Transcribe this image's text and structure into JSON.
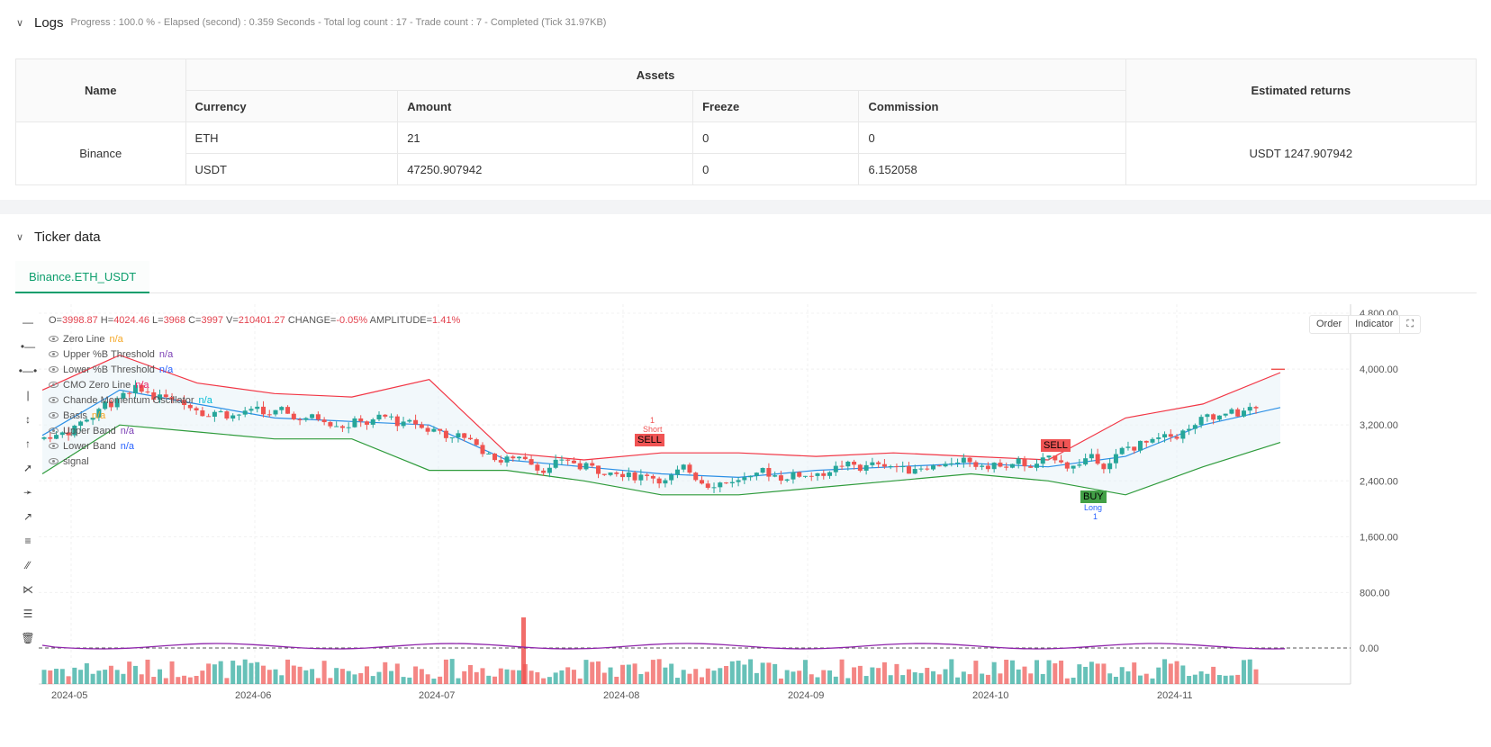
{
  "logs": {
    "title": "Logs",
    "summary": "Progress : 100.0 % - Elapsed (second) : 0.359   Seconds - Total log count : 17 - Trade count : 7 - Completed (Tick 31.97KB)"
  },
  "assets_table": {
    "name_header": "Name",
    "assets_header": "Assets",
    "returns_header": "Estimated returns",
    "columns": [
      "Currency",
      "Amount",
      "Freeze",
      "Commission"
    ],
    "exchange": "Binance",
    "rows": [
      {
        "currency": "ETH",
        "amount": "21",
        "freeze": "0",
        "commission": "0"
      },
      {
        "currency": "USDT",
        "amount": "47250.907942",
        "freeze": "0",
        "commission": "6.152058"
      }
    ],
    "estimated_returns": "USDT 1247.907942"
  },
  "ticker": {
    "title": "Ticker data",
    "tab": "Binance.ETH_USDT"
  },
  "chart": {
    "ohlc": {
      "o": "3998.87",
      "h": "4024.46",
      "l": "3968",
      "c": "3997",
      "v": "210401.27",
      "change": "-0.05%",
      "amplitude": "1.41%"
    },
    "ohlc_labels": {
      "o": "O=",
      "h": " H=",
      "l": " L=",
      "c": " C=",
      "v": " V=",
      "change": " CHANGE=",
      "amplitude": " AMPLITUDE="
    },
    "legend": [
      {
        "name": "Zero Line",
        "value": "n/a",
        "color": "#f5a623"
      },
      {
        "name": "Upper %B Threshold",
        "value": "n/a",
        "color": "#7b3fb5"
      },
      {
        "name": "Lower %B Threshold",
        "value": "n/a",
        "color": "#2962ff"
      },
      {
        "name": "CMO Zero Line",
        "value": "n/a",
        "color": "#e91e63"
      },
      {
        "name": "Chande Momentum Oscillator",
        "value": "n/a",
        "color": "#00bcd4"
      },
      {
        "name": "Basis",
        "value": "n/a",
        "color": "#f5a623"
      },
      {
        "name": "Upper Band",
        "value": "n/a",
        "color": "#7b3fb5"
      },
      {
        "name": "Lower Band",
        "value": "n/a",
        "color": "#2962ff"
      },
      {
        "name": "signal",
        "value": "",
        "color": "#555555"
      }
    ],
    "buttons": {
      "order": "Order",
      "indicator": "Indicator"
    },
    "y_ticks": [
      "4,800.00",
      "4,000.00",
      "3,200.00",
      "2,400.00",
      "1,600.00",
      "800.00"
    ],
    "osc_tick": "0.00",
    "x_ticks": [
      "2024-05",
      "2024-06",
      "2024-07",
      "2024-08",
      "2024-09",
      "2024-10",
      "2024-11"
    ],
    "signals": [
      {
        "label": "SELL",
        "sub": "Short",
        "qty": "1",
        "type": "sell"
      },
      {
        "label": "SELL",
        "type": "sell"
      },
      {
        "label": "BUY",
        "sub": "Long",
        "qty": "1",
        "type": "buy"
      }
    ],
    "colors": {
      "up": "#26a69a",
      "down": "#ef5350",
      "upper": "#f23645",
      "lower": "#2e9b3b",
      "basis": "#2b8fe6",
      "osc": "#8e24aa",
      "sell": "#f05454",
      "buy": "#43a047"
    }
  },
  "chart_data": {
    "type": "candlestick",
    "x": [
      "2024-05",
      "2024-06",
      "2024-07",
      "2024-08",
      "2024-09",
      "2024-10",
      "2024-11"
    ],
    "yrange": [
      0,
      5000
    ],
    "series": [
      {
        "name": "Basis",
        "values": [
          3050,
          3700,
          3500,
          3300,
          3250,
          3200,
          2700,
          2600,
          2500,
          2450,
          2550,
          2600,
          2650,
          2600,
          2750,
          3200,
          3450
        ]
      },
      {
        "name": "Upper Band",
        "values": [
          3700,
          4200,
          3800,
          3650,
          3600,
          3850,
          2800,
          2700,
          2800,
          2800,
          2750,
          2800,
          2750,
          2700,
          3300,
          3500,
          3950
        ]
      },
      {
        "name": "Lower Band",
        "values": [
          2500,
          3200,
          3100,
          3000,
          3000,
          2550,
          2550,
          2400,
          2200,
          2200,
          2300,
          2400,
          2500,
          2400,
          2200,
          2600,
          2950
        ]
      }
    ],
    "last_close": 3997
  }
}
